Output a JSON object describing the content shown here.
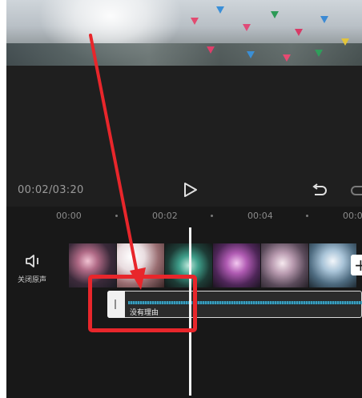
{
  "player": {
    "current_time": "00:02/03:20"
  },
  "timeline": {
    "ruler": [
      "00:00",
      "00:02",
      "00:04",
      "00:0"
    ]
  },
  "track_controls": {
    "mute_label": "关闭原声"
  },
  "audio_clip": {
    "name": "没有理由"
  },
  "add_clip": {
    "label": "+"
  },
  "colors": {
    "annotation": "#e8262b",
    "waveform": "#3db3d9",
    "background": "#1f1f1f"
  },
  "icons": {
    "play": "play-icon",
    "undo": "undo-icon",
    "redo": "redo-icon",
    "mute": "speaker-mute-icon"
  }
}
